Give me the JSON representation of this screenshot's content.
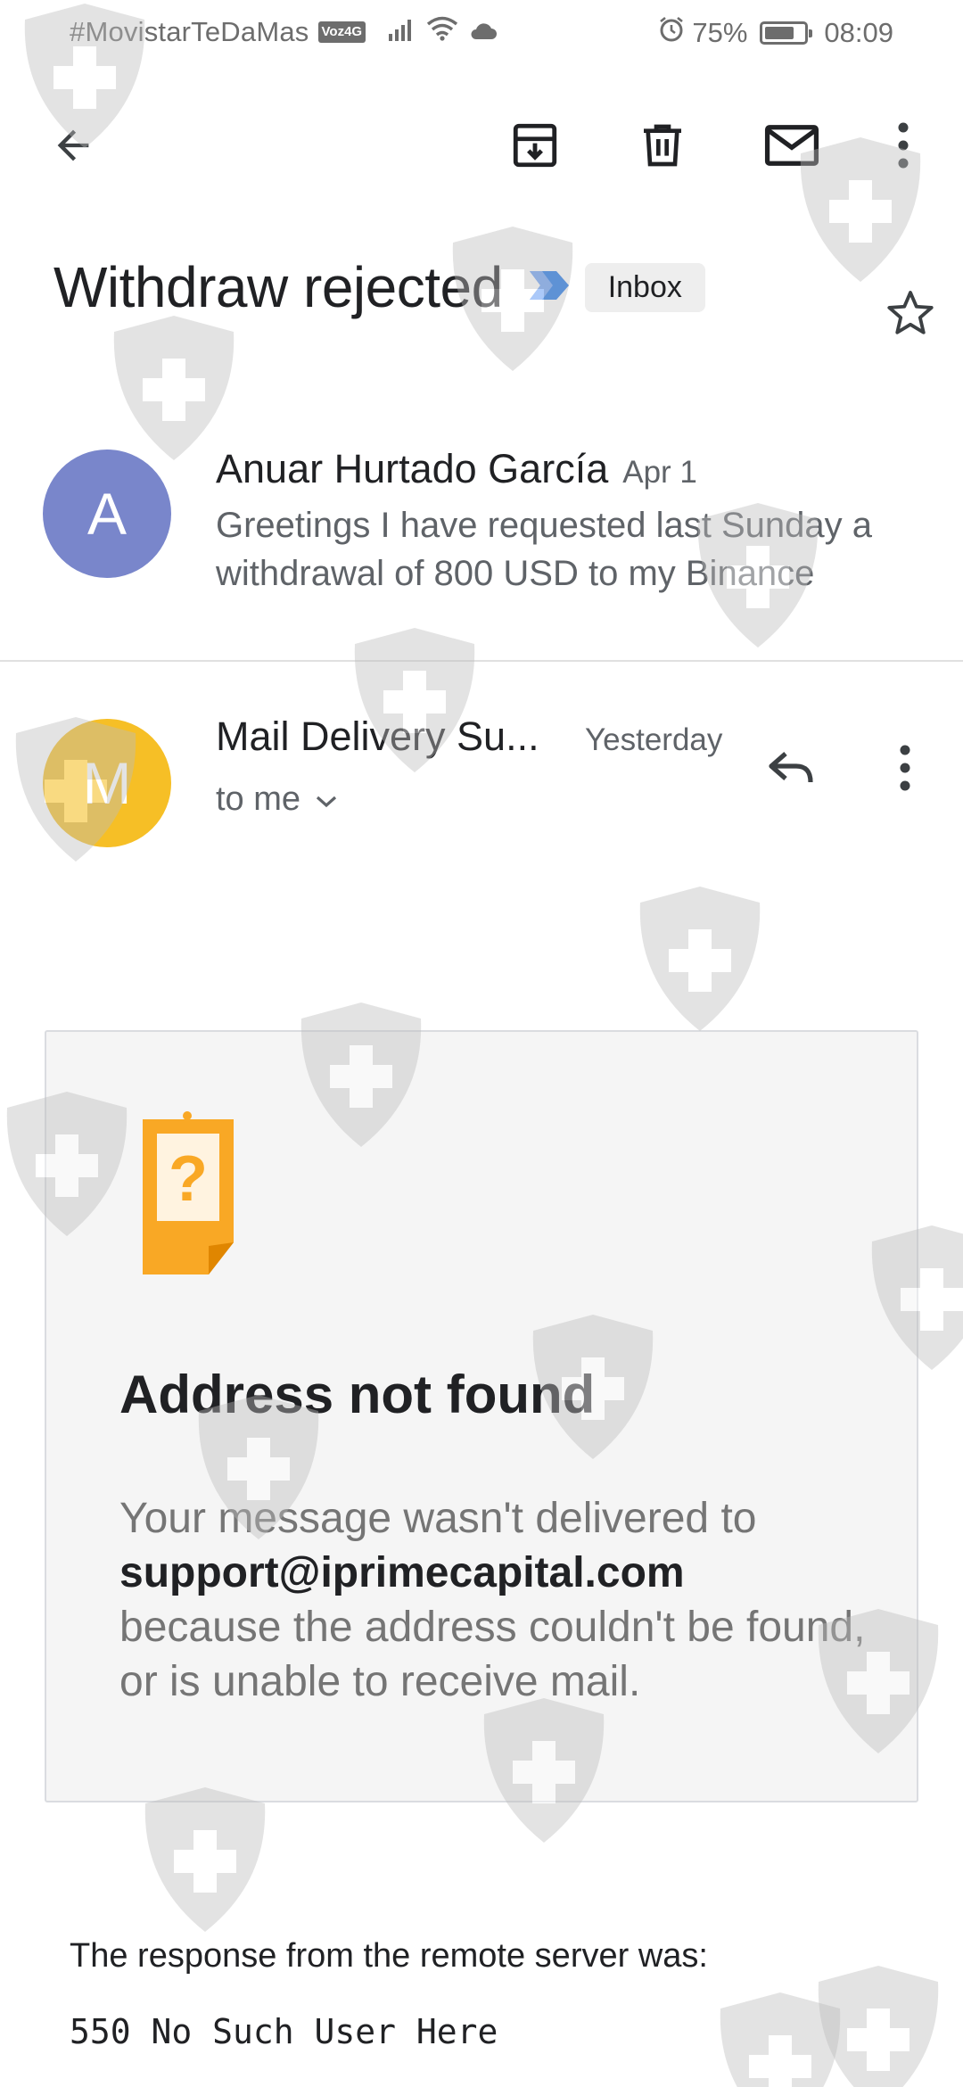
{
  "status_bar": {
    "carrier": "#MovistarTeDaMas",
    "network_badge": "Voz4G",
    "battery": "75%",
    "battery_level": 0.75,
    "time": "08:09",
    "icons": [
      "signal-icon",
      "wifi-icon",
      "cloud-icon",
      "alarm-icon",
      "battery-icon"
    ]
  },
  "toolbar": {
    "back_icon": "arrow-back-icon",
    "archive_icon": "archive-icon",
    "delete_icon": "trash-icon",
    "mark_unread_icon": "mail-icon",
    "more_icon": "more-vert-icon"
  },
  "thread": {
    "subject": "Withdraw rejected",
    "label": "Inbox",
    "importance_icon": "importance-marker-icon",
    "star_icon": "star-outline-icon"
  },
  "messages": [
    {
      "avatar_letter": "A",
      "avatar_color": "#7986cb",
      "sender": "Anuar Hurtado García",
      "date": "Apr 1",
      "snippet": "Greetings I have requested last Sunday a withdrawal of 800 USD to my Binance"
    },
    {
      "avatar_letter": "M",
      "avatar_color": "#f6bf26",
      "sender": "Mail Delivery Su...",
      "date": "Yesterday",
      "recipient": "to me",
      "reply_icon": "reply-icon",
      "more_icon": "more-vert-icon"
    }
  ],
  "bounce": {
    "icon": "address-not-found-icon",
    "title": "Address not found",
    "body_before": "Your message wasn't delivered to",
    "email": "support@iprimecapital.com",
    "body_after": "because the address couldn't be found, or is unable to receive mail."
  },
  "server": {
    "intro": "The response from the remote server was:",
    "code": "550 No Such User Here"
  },
  "colors": {
    "importance": "#1a73e8",
    "bounce_icon": "#f9a825"
  }
}
